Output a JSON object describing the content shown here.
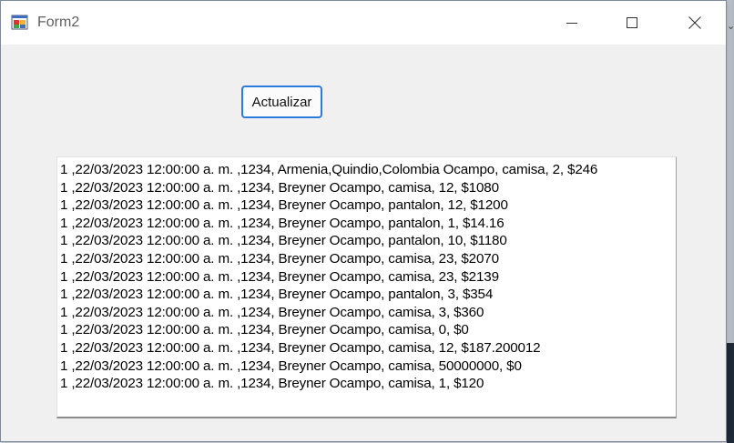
{
  "window": {
    "title": "Form2",
    "icons": {
      "app": "winforms-app-icon",
      "minimize": "minimize-icon",
      "maximize": "maximize-icon",
      "close": "close-icon"
    }
  },
  "form": {
    "update_button_label": "Actualizar",
    "list_items": [
      "1 ,22/03/2023 12:00:00 a. m. ,1234, Armenia,Quindio,Colombia Ocampo, camisa, 2, $246",
      "1 ,22/03/2023 12:00:00 a. m. ,1234, Breyner Ocampo, camisa, 12, $1080",
      "1 ,22/03/2023 12:00:00 a. m. ,1234, Breyner Ocampo, pantalon, 12, $1200",
      "1 ,22/03/2023 12:00:00 a. m. ,1234, Breyner Ocampo, pantalon, 1, $14.16",
      "1 ,22/03/2023 12:00:00 a. m. ,1234, Breyner Ocampo, pantalon, 10, $1180",
      "1 ,22/03/2023 12:00:00 a. m. ,1234, Breyner Ocampo, camisa, 23, $2070",
      "1 ,22/03/2023 12:00:00 a. m. ,1234, Breyner Ocampo, camisa, 23, $2139",
      "1 ,22/03/2023 12:00:00 a. m. ,1234, Breyner Ocampo, pantalon, 3, $354",
      "1 ,22/03/2023 12:00:00 a. m. ,1234, Breyner Ocampo, camisa, 3, $360",
      "1 ,22/03/2023 12:00:00 a. m. ,1234, Breyner Ocampo, camisa, 0, $0",
      "1 ,22/03/2023 12:00:00 a. m. ,1234, Breyner Ocampo, camisa, 12, $187.200012",
      "1 ,22/03/2023 12:00:00 a. m. ,1234, Breyner Ocampo, camisa, 50000000, $0",
      "1 ,22/03/2023 12:00:00 a. m. ,1234, Breyner Ocampo, camisa, 1, $120"
    ]
  },
  "colors": {
    "titlebar": "#ffffff",
    "client": "#f0f0f0",
    "button_focus_border": "#2b7bdc",
    "list_background": "#ffffff"
  }
}
